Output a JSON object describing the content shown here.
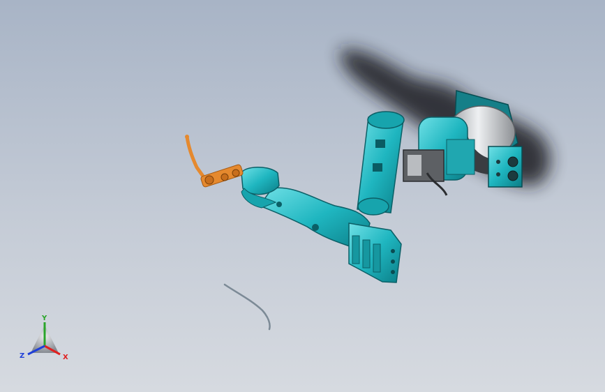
{
  "viewport": {
    "background": "#b9c2cf",
    "colors": {
      "arm_cyan": "#1fb6c0",
      "arm_dark": "#0b6f78",
      "motor_silver": "#d7d9dc",
      "motor_dark": "#6c6f73",
      "torch_orange": "#e5892e",
      "cable_gray": "#7c8a96",
      "shadow": "#1b1f24"
    }
  },
  "model": {
    "parts": [
      {
        "name": "base-motor",
        "icon": "cylinder-motor"
      },
      {
        "name": "connector-panel",
        "icon": "connector-box"
      },
      {
        "name": "upper-arm",
        "icon": "arm-link"
      },
      {
        "name": "forearm",
        "icon": "arm-link"
      },
      {
        "name": "elbow-housing",
        "icon": "housing"
      },
      {
        "name": "wrist",
        "icon": "wrist-joint"
      },
      {
        "name": "welding-torch",
        "icon": "torch"
      },
      {
        "name": "loose-cable",
        "icon": "cable"
      }
    ]
  },
  "triad": {
    "x_label": "X",
    "y_label": "Y",
    "z_label": "Z",
    "x_color": "#e02020",
    "y_color": "#2aa52a",
    "z_color": "#1f3fd8"
  }
}
